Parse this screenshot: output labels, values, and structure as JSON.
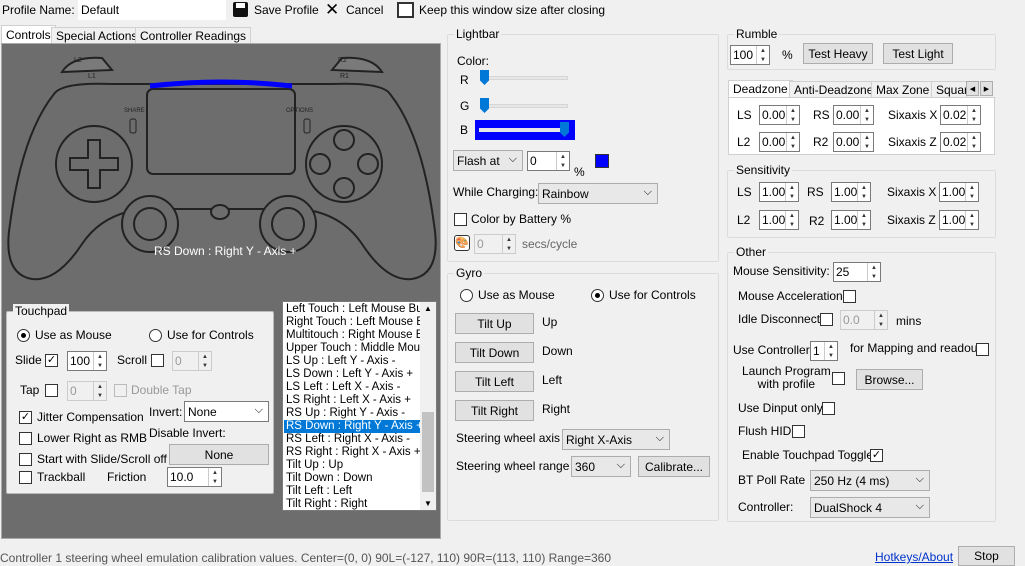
{
  "toolbar": {
    "profile_label": "Profile Name:",
    "profile_value": "Default",
    "save_label": "Save Profile",
    "cancel_label": "Cancel",
    "keep_size_label": "Keep this window size after closing"
  },
  "tabs": [
    "Controls",
    "Special Actions",
    "Controller Readings"
  ],
  "controller": {
    "readout": "RS Down : Right Y - Axis +",
    "btn_labels": {
      "l2": "L2",
      "l1": "L1",
      "r2": "R2",
      "r1": "R1",
      "share": "SHARE",
      "options": "OPTIONS"
    }
  },
  "touchpad": {
    "title": "Touchpad",
    "use_mouse": "Use as Mouse",
    "use_controls": "Use for Controls",
    "slide": "Slide",
    "slide_value": "100",
    "scroll": "Scroll",
    "scroll_value": "0",
    "tap": "Tap",
    "tap_value": "0",
    "double_tap": "Double Tap",
    "jitter": "Jitter Compensation",
    "invert_label": "Invert:",
    "invert_value": "None",
    "lower_right": "Lower Right as RMB",
    "disable_invert": "Disable Invert:",
    "disable_invert_value": "None",
    "start_slide": "Start with Slide/Scroll off",
    "trackball": "Trackball",
    "friction": "Friction",
    "friction_value": "10.0"
  },
  "mapping_list": {
    "items": [
      "Left Touch : Left Mouse Butt",
      "Right Touch : Left Mouse Bu",
      "Multitouch : Right Mouse Bu",
      "Upper Touch : Middle Mouse",
      "LS Up : Left Y - Axis -",
      "LS Down : Left Y - Axis +",
      "LS Left : Left X - Axis -",
      "LS Right : Left X - Axis +",
      "RS Up : Right Y - Axis -",
      "RS Down : Right Y - Axis +",
      "RS Left : Right X - Axis -",
      "RS Right : Right X - Axis +",
      "Tilt Up : Up",
      "Tilt Down : Down",
      "Tilt Left : Left",
      "Tilt Right : Right"
    ],
    "selected_index": 9
  },
  "lightbar": {
    "title": "Lightbar",
    "color_label": "Color:",
    "r": "R",
    "g": "G",
    "b": "B",
    "r_level": 0,
    "g_level": 0,
    "b_level": 1.0,
    "color_hex": "#0000ff",
    "flash_label": "Flash at",
    "flash_value": "0",
    "percent": "%",
    "while_charging": "While Charging:",
    "charging_value": "Rainbow",
    "color_by_battery": "Color by Battery %",
    "secs_value": "0",
    "secs_label": "secs/cycle"
  },
  "gyro": {
    "title": "Gyro",
    "use_mouse": "Use as Mouse",
    "use_controls": "Use for Controls",
    "tilt_up": "Tilt Up",
    "up": "Up",
    "tilt_down": "Tilt Down",
    "down": "Down",
    "tilt_left": "Tilt Left",
    "left": "Left",
    "tilt_right": "Tilt Right",
    "right": "Right",
    "axis_label": "Steering wheel axis",
    "axis_value": "Right X-Axis",
    "range_label": "Steering wheel range",
    "range_value": "360",
    "calibrate": "Calibrate..."
  },
  "rumble": {
    "title": "Rumble",
    "value": "100",
    "percent": "%",
    "test_heavy": "Test Heavy",
    "test_light": "Test Light"
  },
  "deadzone": {
    "tabs": [
      "Deadzone",
      "Anti-Deadzone",
      "Max Zone",
      "Squar"
    ],
    "ls": "LS",
    "ls_value": "0.00",
    "rs": "RS",
    "rs_value": "0.00",
    "sx": "Sixaxis X",
    "sx_value": "0.02",
    "l2": "L2",
    "l2_value": "0.00",
    "r2": "R2",
    "r2_value": "0.00",
    "sz": "Sixaxis Z",
    "sz_value": "0.02"
  },
  "sensitivity": {
    "title": "Sensitivity",
    "ls": "LS",
    "ls_value": "1.00",
    "rs": "RS",
    "rs_value": "1.00",
    "sx": "Sixaxis X",
    "sx_value": "1.00",
    "l2": "L2",
    "l2_value": "1.00",
    "r2": "R2",
    "r2_value": "1.00",
    "sz": "Sixaxis Z",
    "sz_value": "1.00"
  },
  "other": {
    "title": "Other",
    "mouse_sens": "Mouse Sensitivity:",
    "mouse_sens_value": "25",
    "mouse_accel": "Mouse Acceleration",
    "idle": "Idle Disconnect",
    "idle_value": "0.0",
    "mins": "mins",
    "use_controller": "Use Controller",
    "controller_num": "1",
    "for_mapping": "for Mapping and readout",
    "launch": "Launch  Program\nwith profile",
    "browse": "Browse...",
    "use_dinput": "Use Dinput only",
    "flush_hid": "Flush HID",
    "enable_touchpad": "Enable Touchpad Toggle",
    "bt_poll": "BT Poll Rate",
    "bt_poll_value": "250 Hz (4 ms)",
    "controller_label": "Controller:",
    "controller_value": "DualShock 4"
  },
  "status": {
    "text": "Controller 1 steering wheel emulation calibration values. Center=(0, 0)  90L=(-127, 110)  90R=(113, 110)  Range=360",
    "hotkeys": "Hotkeys/About",
    "stop": "Stop"
  }
}
